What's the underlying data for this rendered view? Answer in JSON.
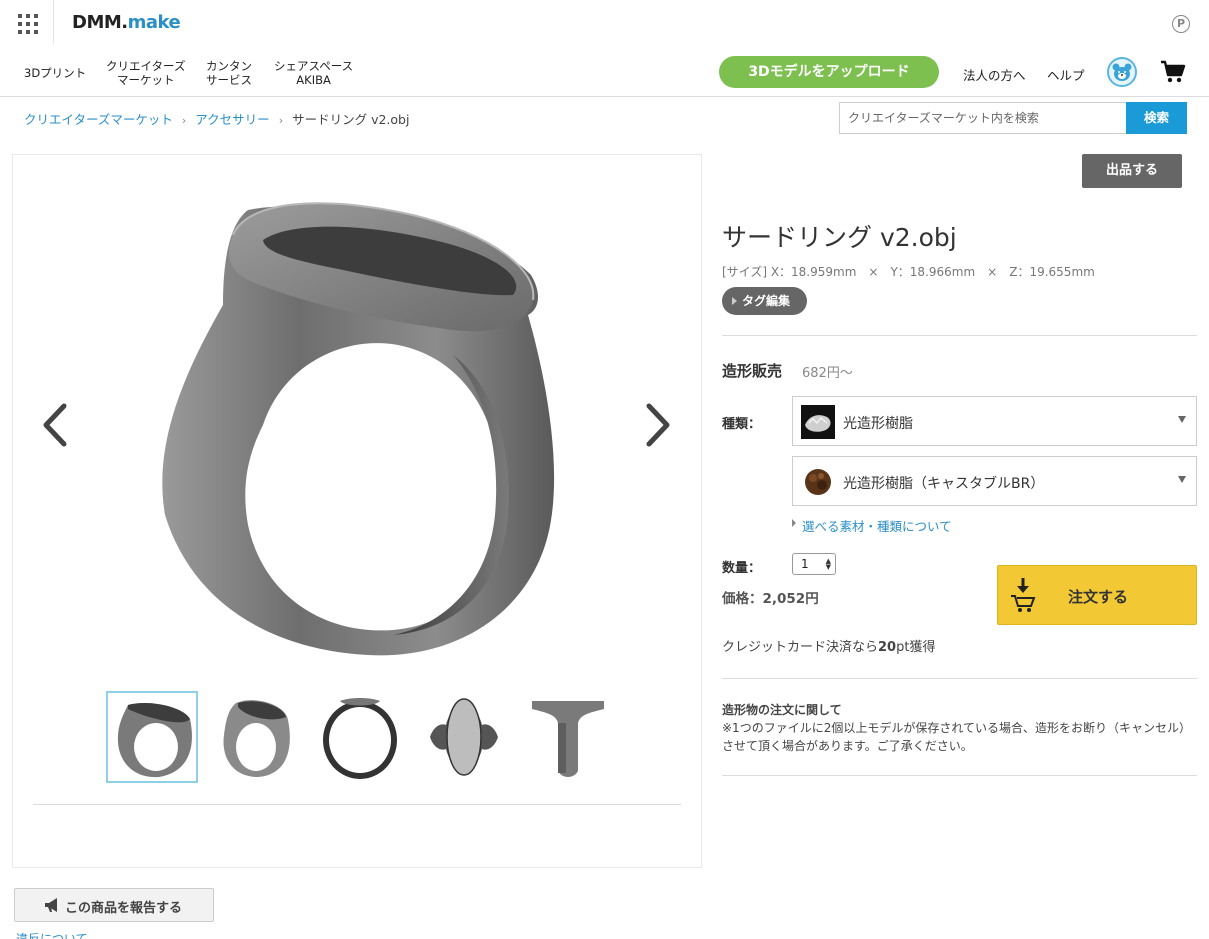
{
  "header": {
    "logo_main": "DMM",
    "logo_dot": ".",
    "logo_sub": "make",
    "point_label": "P"
  },
  "nav": {
    "items": [
      {
        "line1": "3Dプリント",
        "line2": ""
      },
      {
        "line1": "クリエイターズ",
        "line2": "マーケット"
      },
      {
        "line1": "カンタン",
        "line2": "サービス"
      },
      {
        "line1": "シェアスペース",
        "line2": "AKIBA"
      }
    ],
    "upload_label": "3Dモデルをアップロード",
    "corporate_label": "法人の方へ",
    "help_label": "ヘルプ"
  },
  "breadcrumb": {
    "items": [
      "クリエイターズマーケット",
      "アクセサリー"
    ],
    "separator": "›",
    "current": "サードリング v2.obj"
  },
  "search": {
    "placeholder": "クリエイターズマーケット内を検索",
    "value": "",
    "button_label": "検索"
  },
  "listing_button": "出品する",
  "product": {
    "title": "サードリング v2.obj",
    "size_prefix": "[サイズ] X：18.959mm",
    "size_y": "Y：18.966mm",
    "size_z": "Z：19.655mm",
    "size_sep": "×",
    "tag_button": "タグ編集"
  },
  "sale": {
    "label": "造形販売",
    "from_price": "682円〜",
    "kind_label": "種類：",
    "material_1": "光造形樹脂",
    "material_2": "光造形樹脂（キャスタブルBR）",
    "material_link": "選べる素材・種類について",
    "quantity_label": "数量：",
    "quantity_value": "1",
    "price_label": "価格：2,052円",
    "order_button": "注文する",
    "credit_prefix": "クレジットカード決済なら",
    "credit_points": "20",
    "credit_suffix": "pt獲得"
  },
  "notice": {
    "title": "造形物の注文に関して",
    "body": "※1つのファイルに2個以上モデルが保存されている場合、造形をお断り（キャンセル）させて頂く場合があります。ご了承ください。"
  },
  "report_button": "この商品を報告する",
  "violation_link": "違反について",
  "colors": {
    "accent_green": "#7dc04f",
    "link_blue": "#2b8fc8",
    "search_blue": "#1a9ad6",
    "order_yellow": "#f2c934"
  }
}
